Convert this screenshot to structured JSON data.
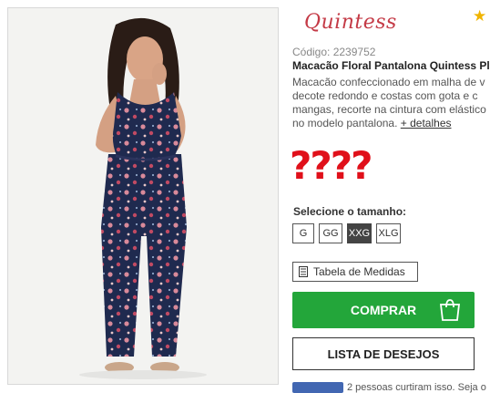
{
  "brand": {
    "name": "Quintess"
  },
  "product": {
    "code": "Código: 2239752",
    "title": "Macacão Floral Pantalona Quintess Plu",
    "description_lines": [
      "Macacão confeccionado em malha de v",
      "decote redondo e costas com gota e c",
      "mangas, recorte na cintura com elástico",
      "no modelo pantalona."
    ],
    "more_details": "+ detalhes",
    "price_placeholder": "????"
  },
  "sizes": {
    "label": "Selecione o tamanho:",
    "options": [
      "G",
      "GG",
      "XXG",
      "XLG"
    ],
    "selected": "XXG"
  },
  "measures": {
    "label": "Tabela de Medidas"
  },
  "actions": {
    "buy": "COMPRAR",
    "wishlist": "LISTA DE DESEJOS"
  },
  "social": {
    "text": "2 pessoas curtiram isso. Seja o"
  },
  "colors": {
    "buy_green": "#23a63a",
    "brand_red": "#c43a46",
    "price_red": "#e0101a",
    "star_gold": "#f0b400"
  },
  "icons": {
    "favorite": "star-icon",
    "bag": "shopping-bag-icon",
    "measure": "document-icon"
  }
}
